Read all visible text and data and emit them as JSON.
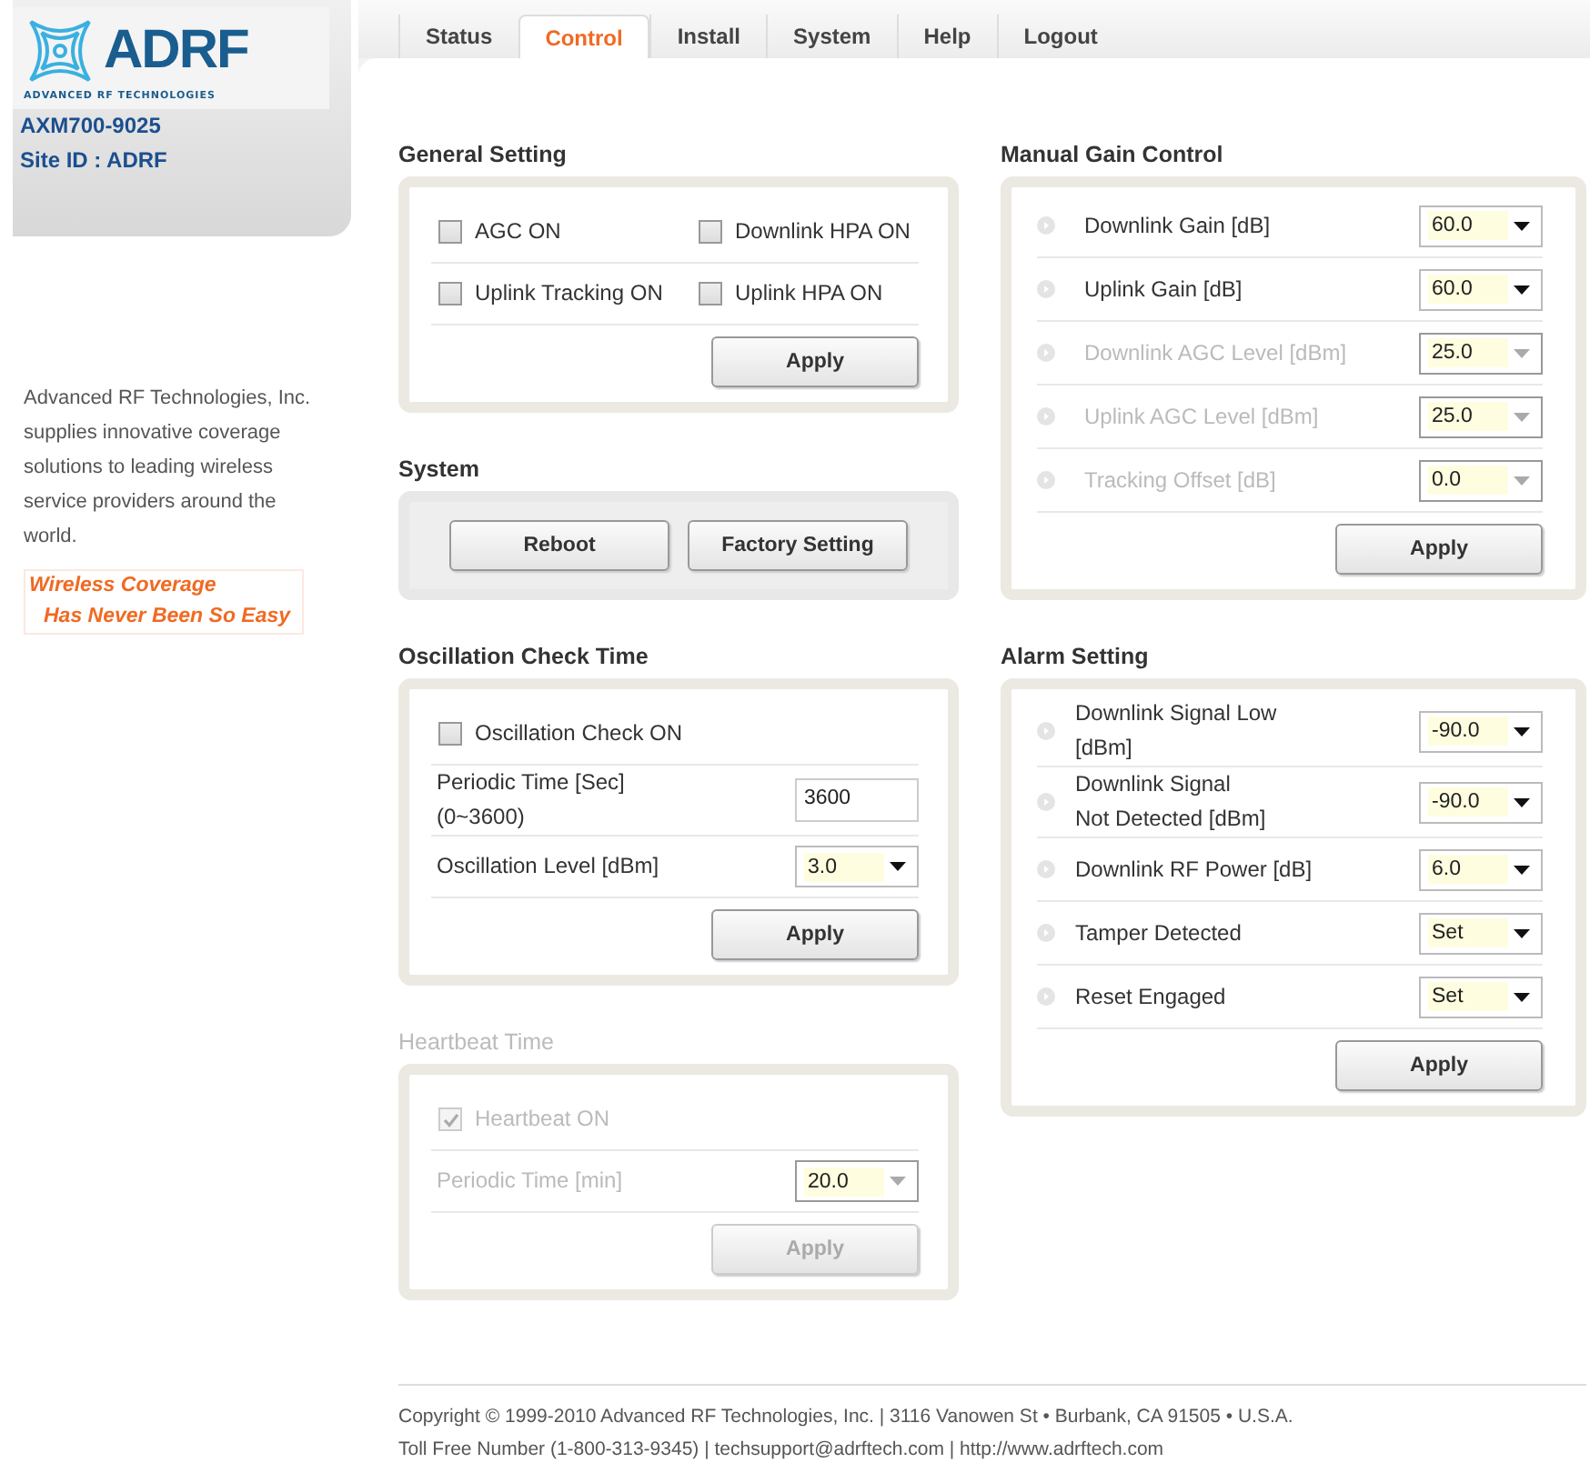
{
  "sidebar": {
    "logo_text": "ADRF",
    "logo_tagline": "ADVANCED RF TECHNOLOGIES",
    "model": "AXM700-9025",
    "site_id": "Site ID : ADRF",
    "description": "Advanced RF Technologies, Inc. supplies innovative coverage solutions to leading wireless service providers around the world.",
    "slogan": [
      "Wireless Coverage",
      "Has Never Been So Easy"
    ]
  },
  "tabs": [
    {
      "label": "Status",
      "selected": false
    },
    {
      "label": "Control",
      "selected": true
    },
    {
      "label": "Install",
      "selected": false
    },
    {
      "label": "System",
      "selected": false
    },
    {
      "label": "Help",
      "selected": false
    },
    {
      "label": "Logout",
      "selected": false
    }
  ],
  "general_setting": {
    "title": "General Setting",
    "checkboxes": [
      {
        "label": "AGC ON",
        "checked": false
      },
      {
        "label": "Downlink HPA ON",
        "checked": false
      },
      {
        "label": "Uplink Tracking ON",
        "checked": false
      },
      {
        "label": "Uplink HPA ON",
        "checked": false
      }
    ],
    "apply": "Apply"
  },
  "system": {
    "title": "System",
    "buttons": [
      "Reboot",
      "Factory Setting"
    ]
  },
  "oscillation": {
    "title": "Oscillation Check Time",
    "checkbox": {
      "label": "Oscillation Check ON",
      "checked": false
    },
    "rows": [
      {
        "kind": "input",
        "label": "Periodic Time [Sec]\n(0~3600)",
        "value": "3600"
      },
      {
        "kind": "select",
        "label": "Oscillation Level [dBm]",
        "value": "3.0"
      }
    ],
    "apply": "Apply"
  },
  "heartbeat": {
    "title": "Heartbeat Time",
    "disabled": true,
    "checkbox": {
      "label": "Heartbeat ON",
      "checked": true
    },
    "rows": [
      {
        "kind": "select",
        "label": "Periodic Time [min]",
        "value": "20.0"
      }
    ],
    "apply": "Apply"
  },
  "manual_gain": {
    "title": "Manual Gain Control",
    "rows": [
      {
        "label": "Downlink Gain [dB]",
        "value": "60.0",
        "disabled": false
      },
      {
        "label": "Uplink Gain [dB]",
        "value": "60.0",
        "disabled": false
      },
      {
        "label": "Downlink AGC Level [dBm]",
        "value": "25.0",
        "disabled": true
      },
      {
        "label": "Uplink AGC Level [dBm]",
        "value": "25.0",
        "disabled": true
      },
      {
        "label": "Tracking Offset [dB]",
        "value": "0.0",
        "disabled": true
      }
    ],
    "apply": "Apply"
  },
  "alarm": {
    "title": "Alarm Setting",
    "rows": [
      {
        "label": "Downlink Signal Low\n[dBm]",
        "value": "-90.0"
      },
      {
        "label": "Downlink Signal\nNot Detected [dBm]",
        "value": "-90.0"
      },
      {
        "label": "Downlink RF Power [dB]",
        "value": "6.0"
      },
      {
        "label": "Tamper Detected",
        "value": "Set"
      },
      {
        "label": "Reset Engaged",
        "value": "Set"
      }
    ],
    "apply": "Apply"
  },
  "footer": [
    "Copyright © 1999-2010 Advanced RF Technologies, Inc. | 3116 Vanowen St • Burbank, CA 91505 • U.S.A.",
    "Toll Free Number (1-800-313-9345) | techsupport@adrftech.com | http://www.adrftech.com"
  ]
}
